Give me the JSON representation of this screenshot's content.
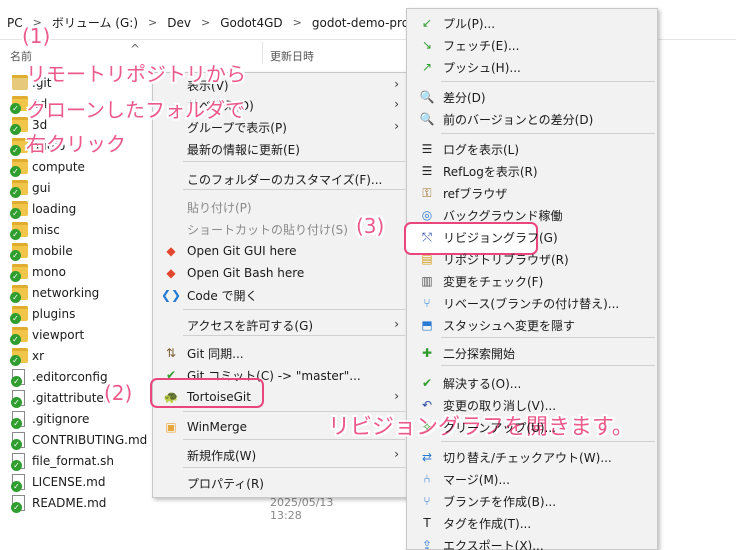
{
  "breadcrumb": [
    "PC",
    "ボリューム (G:)",
    "Dev",
    "Godot4GD",
    "godot-demo-projects-master"
  ],
  "columns": {
    "name": "名前",
    "sort_icon": "^",
    "date": "更新日時"
  },
  "files": [
    {
      "name": ".git",
      "type": "git-folder",
      "date": ""
    },
    {
      "name": "2d",
      "type": "folder",
      "date": ""
    },
    {
      "name": "3d",
      "type": "folder",
      "date": ""
    },
    {
      "name": "audio",
      "type": "folder",
      "date": ""
    },
    {
      "name": "compute",
      "type": "folder",
      "date": ""
    },
    {
      "name": "gui",
      "type": "folder",
      "date": ""
    },
    {
      "name": "loading",
      "type": "folder",
      "date": ""
    },
    {
      "name": "misc",
      "type": "folder",
      "date": ""
    },
    {
      "name": "mobile",
      "type": "folder",
      "date": ""
    },
    {
      "name": "mono",
      "type": "folder",
      "date": ""
    },
    {
      "name": "networking",
      "type": "folder",
      "date": ""
    },
    {
      "name": "plugins",
      "type": "folder",
      "date": ""
    },
    {
      "name": "viewport",
      "type": "folder",
      "date": ""
    },
    {
      "name": "xr",
      "type": "folder",
      "date": ""
    },
    {
      "name": ".editorconfig",
      "type": "file",
      "date": ""
    },
    {
      "name": ".gitattributes",
      "type": "file",
      "date": ""
    },
    {
      "name": ".gitignore",
      "type": "file",
      "date": ""
    },
    {
      "name": "CONTRIBUTING.md",
      "type": "file",
      "date": ""
    },
    {
      "name": "file_format.sh",
      "type": "file",
      "date": ""
    },
    {
      "name": "LICENSE.md",
      "type": "file",
      "date": "2025/05/13 13:28"
    },
    {
      "name": "README.md",
      "type": "file",
      "date": "2025/05/13 13:28"
    }
  ],
  "context_menu": [
    {
      "label": "表示(V)",
      "submenu": true
    },
    {
      "label": "並べ替え(O)",
      "submenu": true
    },
    {
      "label": "グループで表示(P)",
      "submenu": true
    },
    {
      "label": "最新の情報に更新(E)"
    },
    {
      "label": "このフォルダーのカスタマイズ(F)..."
    },
    {
      "label": "貼り付け(P)",
      "disabled": true
    },
    {
      "label": "ショートカットの貼り付け(S)",
      "disabled": true
    },
    {
      "label": "Open Git GUI here",
      "icon": "git-gui-icon"
    },
    {
      "label": "Open Git Bash here",
      "icon": "git-bash-icon"
    },
    {
      "label": "Code で開く",
      "icon": "vscode-icon"
    },
    {
      "label": "アクセスを許可する(G)",
      "submenu": true
    },
    {
      "label": "Git 同期...",
      "icon": "git-sync-icon"
    },
    {
      "label": "Git コミット(C) -> \"master\"...",
      "icon": "git-commit-icon"
    },
    {
      "label": "TortoiseGit",
      "icon": "tortoisegit-icon",
      "submenu": true
    },
    {
      "label": "WinMerge",
      "icon": "winmerge-icon"
    },
    {
      "label": "新規作成(W)",
      "submenu": true
    },
    {
      "label": "プロパティ(R)"
    }
  ],
  "tortoise_menu": [
    {
      "label": "プル(P)...",
      "icon": "pull-icon"
    },
    {
      "label": "フェッチ(E)...",
      "icon": "fetch-icon"
    },
    {
      "label": "プッシュ(H)...",
      "icon": "push-icon"
    },
    {
      "label": "差分(D)",
      "icon": "diff-icon"
    },
    {
      "label": "前のバージョンとの差分(D)",
      "icon": "diff-prev-icon"
    },
    {
      "label": "ログを表示(L)",
      "icon": "log-icon"
    },
    {
      "label": "RefLogを表示(R)",
      "icon": "reflog-icon"
    },
    {
      "label": "refブラウザ",
      "icon": "ref-browser-icon"
    },
    {
      "label": "バックグラウンド稼働",
      "icon": "daemon-icon"
    },
    {
      "label": "リビジョングラフ(G)",
      "icon": "revision-graph-icon"
    },
    {
      "label": "リポジトリブラウザ(R)",
      "icon": "repo-browser-icon"
    },
    {
      "label": "変更をチェック(F)",
      "icon": "check-changes-icon"
    },
    {
      "label": "リベース(ブランチの付け替え)...",
      "icon": "rebase-icon"
    },
    {
      "label": "スタッシュへ変更を隠す",
      "icon": "stash-icon"
    },
    {
      "label": "二分探索開始",
      "icon": "bisect-icon"
    },
    {
      "label": "解決する(O)...",
      "icon": "resolve-icon"
    },
    {
      "label": "変更の取り消し(V)...",
      "icon": "revert-icon"
    },
    {
      "label": "クリーンアップ(U)...",
      "icon": "cleanup-icon"
    },
    {
      "label": "切り替え/チェックアウト(W)...",
      "icon": "switch-icon"
    },
    {
      "label": "マージ(M)...",
      "icon": "merge-icon"
    },
    {
      "label": "ブランチを作成(B)...",
      "icon": "branch-icon"
    },
    {
      "label": "タグを作成(T)...",
      "icon": "tag-icon"
    },
    {
      "label": "エクスポート(X)...",
      "icon": "export-icon"
    }
  ],
  "annotations": {
    "step1_num": "(1)",
    "step1_lines": [
      "リモートリポジトリから",
      "クローンしたフォルダで",
      "右クリック"
    ],
    "step2": "(2)",
    "step3": "(3)",
    "caption": "リビジョングラフを開きます。"
  },
  "colors": {
    "accent": "#e8467c",
    "annotation": "#ec5a8a",
    "menu_bg": "#f2f2f2"
  }
}
